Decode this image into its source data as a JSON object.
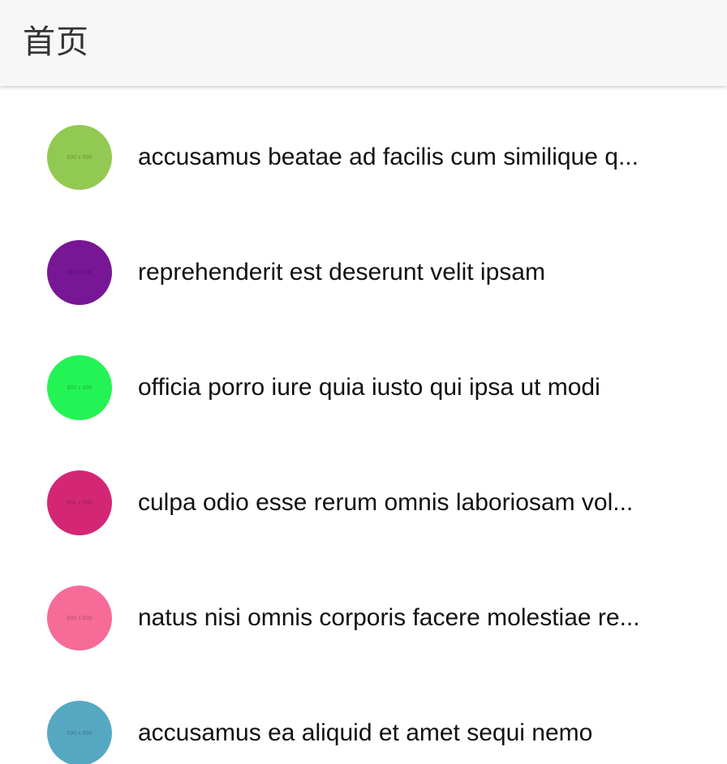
{
  "app_bar": {
    "title": "首页"
  },
  "list": {
    "items": [
      {
        "title": "accusamus beatae ad facilis cum similique q...",
        "avatar_label": "600 x 600",
        "avatar_color": "#92c952"
      },
      {
        "title": "reprehenderit est deserunt velit ipsam",
        "avatar_label": "600 x 600",
        "avatar_color": "#771796"
      },
      {
        "title": "officia porro iure quia iusto qui ipsa ut modi",
        "avatar_label": "600 x 600",
        "avatar_color": "#24f355"
      },
      {
        "title": "culpa odio esse rerum omnis laboriosam vol...",
        "avatar_label": "600 x 600",
        "avatar_color": "#d32776"
      },
      {
        "title": "natus nisi omnis corporis facere molestiae re...",
        "avatar_label": "600 x 600",
        "avatar_color": "#f66b97"
      },
      {
        "title": "accusamus ea aliquid et amet sequi nemo",
        "avatar_label": "600 x 600",
        "avatar_color": "#56a8c2"
      }
    ]
  }
}
